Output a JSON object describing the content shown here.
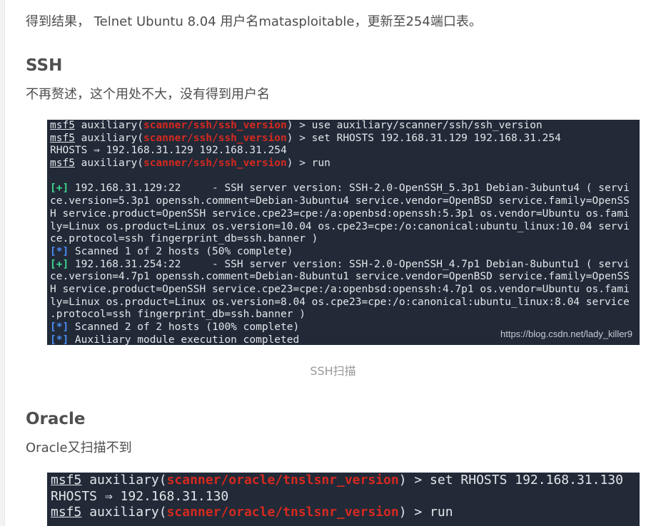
{
  "article": {
    "intro_text": "得到结果， Telnet Ubuntu 8.04 用户名matasploitable，更新至254端口表。",
    "ssh_section": {
      "heading": "SSH",
      "paragraph": "不再赘述，这个用处不大，没有得到用户名",
      "caption": "SSH扫描",
      "watermark": "https://blog.csdn.net/lady_killer9"
    },
    "oracle_section": {
      "heading": "Oracle",
      "paragraph": "Oracle又扫描不到"
    }
  },
  "terminal_ssh": {
    "prompt_word": "msf5",
    "prompt_prefix": " auxiliary(",
    "module": "scanner/ssh/ssh_version",
    "prompt_suffix": ") > ",
    "cmd1": "use auxiliary/scanner/ssh/ssh_version",
    "cmd2": "set RHOSTS 192.168.31.129 192.168.31.254",
    "rhosts_echo": "RHOSTS ⇒ 192.168.31.129 192.168.31.254",
    "cmd3": "run",
    "plus_marker": "[+]",
    "star_marker": "[*]",
    "result1_lines": [
      " 192.168.31.129:22     - SSH server version: SSH-2.0-OpenSSH_5.3p1 Debian-3ubuntu4 ( servi",
      "ce.version=5.3p1 openssh.comment=Debian-3ubuntu4 service.vendor=OpenBSD service.family=OpenSS",
      "H service.product=OpenSSH service.cpe23=cpe:/a:openbsd:openssh:5.3p1 os.vendor=Ubuntu os.fami",
      "ly=Linux os.product=Linux os.version=10.04 os.cpe23=cpe:/o:canonical:ubuntu_linux:10.04 servi",
      "ce.protocol=ssh fingerprint_db=ssh.banner )"
    ],
    "scanned1": " Scanned 1 of 2 hosts (50% complete)",
    "result2_lines": [
      " 192.168.31.254:22     - SSH server version: SSH-2.0-OpenSSH_4.7p1 Debian-8ubuntu1 ( servi",
      "ce.version=4.7p1 openssh.comment=Debian-8ubuntu1 service.vendor=OpenBSD service.family=OpenSS",
      "H service.product=OpenSSH service.cpe23=cpe:/a:openbsd:openssh:4.7p1 os.vendor=Ubuntu os.fami",
      "ly=Linux os.product=Linux os.version=8.04 os.cpe23=cpe:/o:canonical:ubuntu_linux:8.04 service",
      ".protocol=ssh fingerprint_db=ssh.banner )"
    ],
    "scanned2": " Scanned 2 of 2 hosts (100% complete)",
    "completed": " Auxiliary module execution completed"
  },
  "terminal_oracle": {
    "prompt_word": "msf5",
    "prompt_prefix": " auxiliary(",
    "module": "scanner/oracle/tnslsnr_version",
    "prompt_suffix": ") > ",
    "cmd1": "set RHOSTS 192.168.31.130",
    "rhosts_echo": "RHOSTS ⇒ 192.168.31.130",
    "cmd2": "run"
  },
  "colors": {
    "terminal_bg": "#222a38",
    "module_red": "#d4291f",
    "plus_green": "#3dd68c",
    "star_blue": "#4a8cf2",
    "text": "#4d4d4d"
  }
}
